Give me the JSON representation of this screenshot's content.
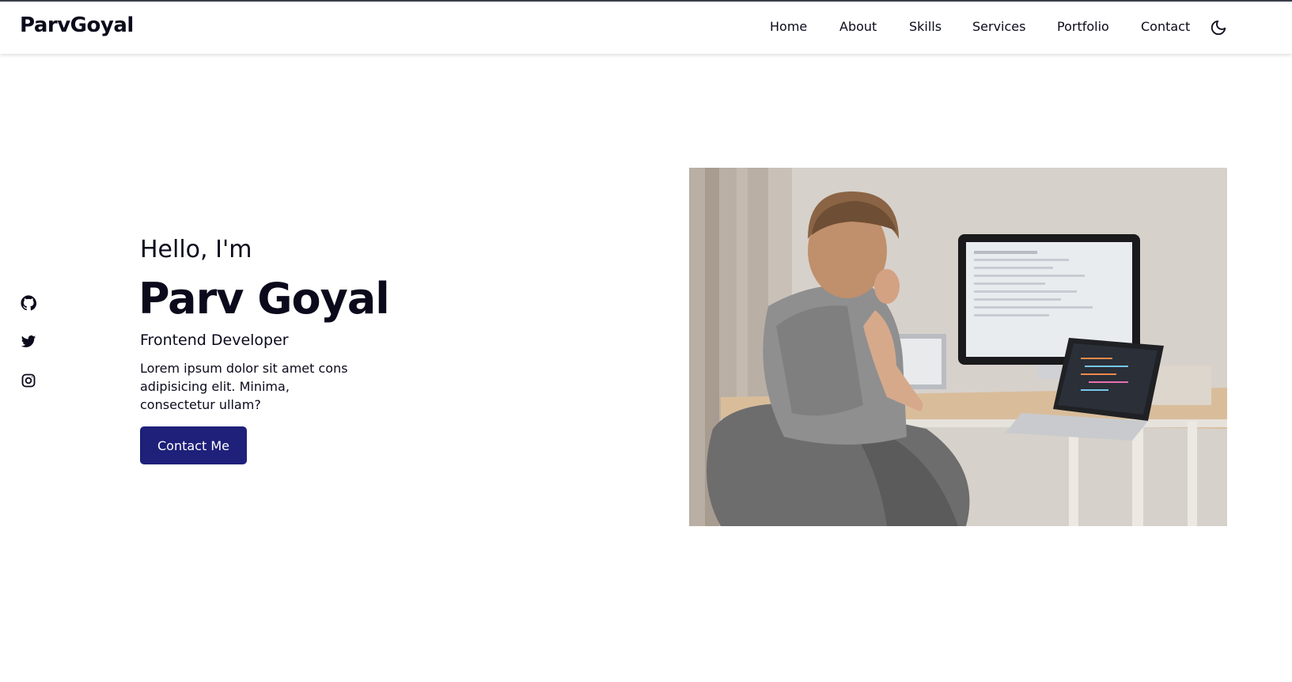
{
  "header": {
    "logo": "ParvGoyal",
    "nav": [
      {
        "label": "Home"
      },
      {
        "label": "About"
      },
      {
        "label": "Skills"
      },
      {
        "label": "Services"
      },
      {
        "label": "Portfolio"
      },
      {
        "label": "Contact"
      }
    ],
    "theme_toggle_icon": "moon-icon"
  },
  "social": [
    {
      "icon": "github-icon"
    },
    {
      "icon": "twitter-icon"
    },
    {
      "icon": "instagram-icon"
    }
  ],
  "hero": {
    "greeting": "Hello, I'm",
    "name": "Parv Goyal",
    "role": "Frontend Developer",
    "description": "Lorem ipsum dolor sit amet cons adipisicing elit. Minima, consectetur ullam?",
    "cta_label": "Contact Me",
    "cta_color": "#1e207a"
  },
  "colors": {
    "text": "#0b0a1c",
    "accent": "#1e207a"
  }
}
